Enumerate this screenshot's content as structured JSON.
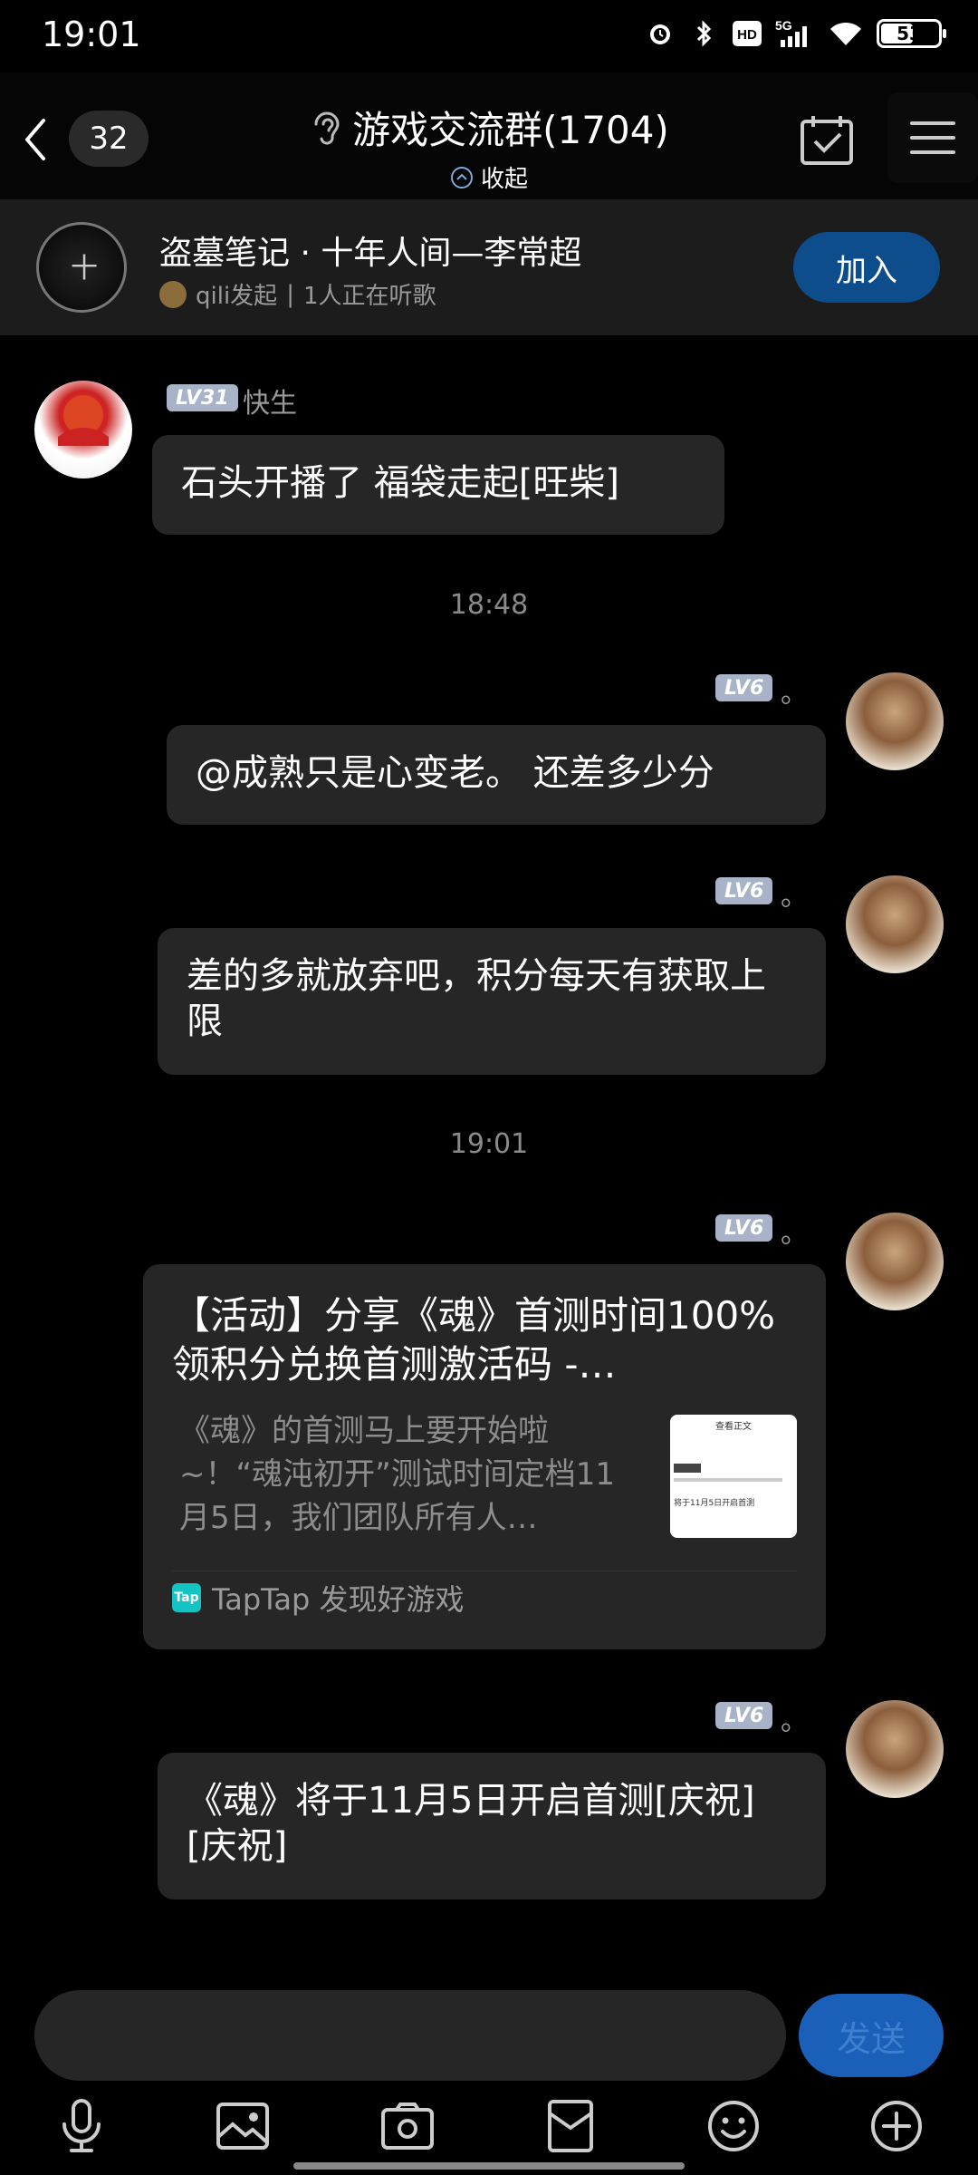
{
  "status_bar": {
    "time": "19:01",
    "network": "5G",
    "hd": "HD",
    "battery": "53",
    "battery_level": 0.53,
    "icons": [
      "alarm-icon",
      "bluetooth-icon",
      "hd-icon",
      "signal-icon",
      "wifi-icon",
      "battery-icon"
    ]
  },
  "header": {
    "unread_count": "32",
    "title": "游戏交流群(1704)",
    "collapse_label": "收起"
  },
  "listen_together": {
    "song_title": "盗墓笔记 · 十年人间—李常超",
    "initiator": "qili发起",
    "separator": "|",
    "listeners": "1人正在听歌",
    "join_label": "加入"
  },
  "messages": [
    {
      "id": "m1",
      "side": "left",
      "level": "LV31",
      "nickname": "快生",
      "text": "石头开播了  福袋走起[旺柴]"
    },
    {
      "id": "ts1",
      "type": "timestamp",
      "text": "18:48"
    },
    {
      "id": "m2",
      "side": "right",
      "level": "LV6",
      "nickname": "。",
      "text": "@成熟只是心变老。 还差多少分"
    },
    {
      "id": "m3",
      "side": "right",
      "level": "LV6",
      "nickname": "。",
      "text": "差的多就放弃吧，积分每天有获取上限"
    },
    {
      "id": "ts2",
      "type": "timestamp",
      "text": "19:01"
    },
    {
      "id": "m4",
      "side": "right",
      "level": "LV6",
      "nickname": "。",
      "type": "card",
      "card_title": "【活动】分享《魂》首测时间100%领积分兑换首测激活码 -…",
      "card_desc": "《魂》的首测马上要开始啦~！“魂沌初开”测试时间定档11月5日，我们团队所有人…",
      "card_source": "TapTap 发现好游戏",
      "card_logo": "Tap",
      "thumb_header": "查看正文",
      "thumb_line": "将于11月5日开启首测"
    },
    {
      "id": "m5",
      "side": "right",
      "level": "LV6",
      "nickname": "。",
      "text": "《魂》将于11月5日开启首测[庆祝][庆祝]"
    }
  ],
  "composer": {
    "input_value": "",
    "send_label": "发送"
  },
  "toolbar_icons": [
    "microphone-icon",
    "image-icon",
    "camera-icon",
    "red-packet-icon",
    "emoji-icon",
    "plus-icon"
  ],
  "colors": {
    "background": "#000000",
    "bubble": "#262626",
    "join_button": "#0d4d8c",
    "send_button": "#1a5fb8",
    "level_badge": "#a9b3c8",
    "muted_text": "#9a9a9a"
  }
}
